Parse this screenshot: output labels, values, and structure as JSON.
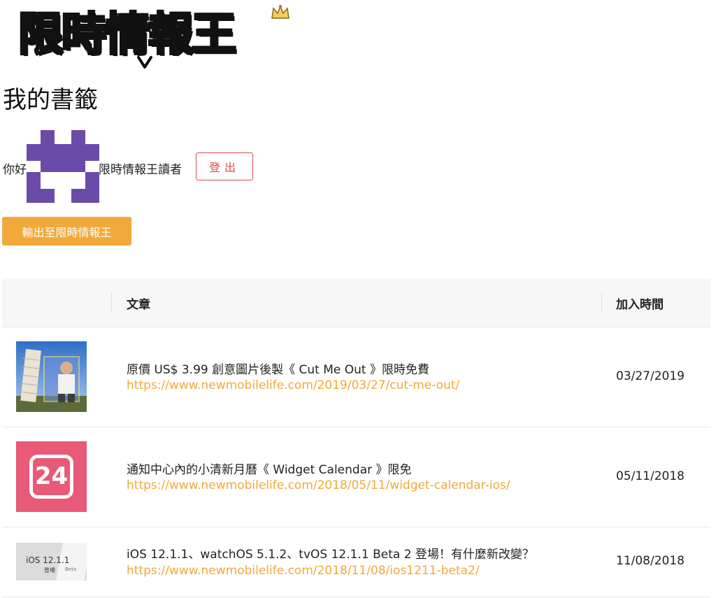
{
  "logo": {
    "text": "限時情報王"
  },
  "page": {
    "title": "我的書籤"
  },
  "greeting": {
    "prefix": "你好",
    "suffix": "限時情報王讀者",
    "logout_label": "登出"
  },
  "export_label": "輸出至限時情報王",
  "table": {
    "headers": {
      "article": "文章",
      "added_time": "加入時間"
    },
    "rows": [
      {
        "title": "原價 US$ 3.99 創意圖片後製《 Cut Me Out 》限時免費",
        "url": "https://www.newmobilelife.com/2019/03/27/cut-me-out/",
        "date": "03/27/2019",
        "thumb_icon": "leaning-tower-photo"
      },
      {
        "title": "通知中心內的小清新月曆《 Widget Calendar 》限免",
        "url": "https://www.newmobilelife.com/2018/05/11/widget-calendar-ios/",
        "date": "05/11/2018",
        "thumb_icon": "calendar-24-icon",
        "thumb_text": "24"
      },
      {
        "title": "iOS 12.1.1、watchOS 5.1.2、tvOS 12.1.1 Beta 2 登場！有什麼新改變？",
        "url": "https://www.newmobilelife.com/2018/11/08/ios1211-beta2/",
        "date": "11/08/2018",
        "thumb_icon": "ios-release-photo",
        "thumb_text": "iOS 12.1.1",
        "thumb_subtext": "登場",
        "thumb_beta": "Beta"
      }
    ]
  },
  "colors": {
    "accent": "#f1a93a",
    "logout": "#e24b4b",
    "avatar": "#6b4ba8",
    "calendar_bg": "#e85a78"
  }
}
